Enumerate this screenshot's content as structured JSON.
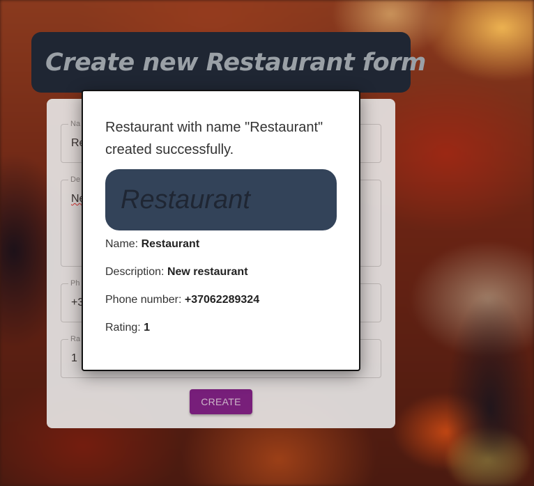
{
  "background": {
    "form_title": "Create new Restaurant form",
    "form": {
      "fields": [
        {
          "label": "Na",
          "value": "Re"
        },
        {
          "label": "De",
          "value": "Ne"
        },
        {
          "label": "Ph",
          "value": "+3"
        },
        {
          "label": "Ra",
          "value": "1"
        }
      ],
      "create_label": "CREATE"
    }
  },
  "dialog": {
    "message": "Restaurant with name \"Restaurant\" created successfully.",
    "banner_title": "Restaurant",
    "details": [
      {
        "label": "Name:",
        "value": "Restaurant"
      },
      {
        "label": "Description:",
        "value": "New restaurant"
      },
      {
        "label": "Phone number:",
        "value": "+37062289324"
      },
      {
        "label": "Rating:",
        "value": "1"
      }
    ]
  },
  "colors": {
    "title_bg": "#1f2633",
    "banner_bg": "#334359",
    "create_button": "#7b1f86",
    "dialog_bg": "#ffffff"
  }
}
